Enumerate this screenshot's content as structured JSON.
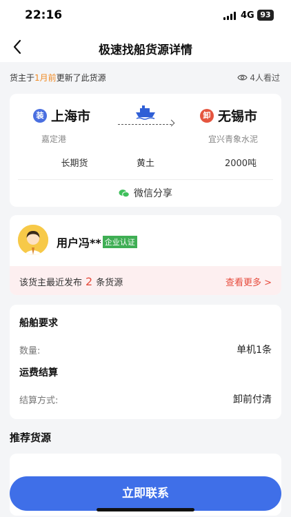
{
  "status_bar": {
    "time": "22:16",
    "network": "4G",
    "battery": "93"
  },
  "nav": {
    "title": "极速找船货源详情",
    "back_icon": "chevron-left-icon"
  },
  "update_info": {
    "prefix": "货主于",
    "time_ago": "1月前",
    "suffix": "更新了此货源",
    "viewers": "4人看过"
  },
  "route": {
    "load_badge": "装",
    "from_city": "上海市",
    "from_port": "嘉定港",
    "unload_badge": "卸",
    "to_city": "无锡市",
    "to_port": "宜兴青象水泥",
    "specs": [
      "长期货",
      "黄土",
      "2000吨"
    ],
    "share_label": "微信分享"
  },
  "owner": {
    "name": "用户冯**",
    "cert_label": "企业认证",
    "recent_prefix": "该货主最近发布",
    "recent_count": "2",
    "recent_suffix": "条货源",
    "more_label": "查看更多 >"
  },
  "requirements": {
    "title": "船舶要求",
    "quantity_label": "数量:",
    "quantity_value": "单机1条",
    "freight_title": "运费结算",
    "settlement_label": "结算方式:",
    "settlement_value": "卸前付清"
  },
  "recommend": {
    "title": "推荐货源"
  },
  "contact_button": "立即联系",
  "colors": {
    "accent_blue": "#3f6fe8",
    "load_blue": "#4a6fe0",
    "unload_red": "#e5553f",
    "highlight_orange": "#f08a24",
    "cert_green": "#3fae54",
    "alert_red": "#e64b3c",
    "wechat_green": "#3fbf5b"
  }
}
